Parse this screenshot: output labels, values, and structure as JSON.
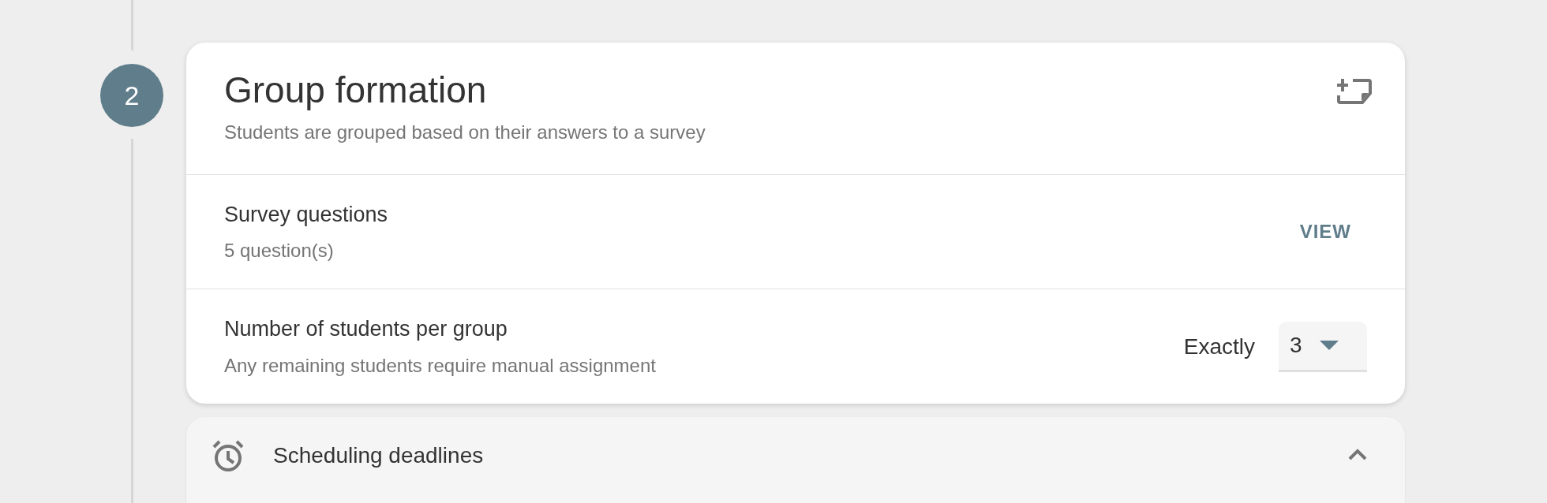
{
  "step": {
    "number": "2"
  },
  "card": {
    "title": "Group formation",
    "subtitle": "Students are grouped based on their answers to a survey",
    "rows": [
      {
        "kind": "action",
        "label": "Survey questions",
        "detail": "5 question(s)",
        "action": "VIEW"
      },
      {
        "kind": "select",
        "label": "Number of students per group",
        "detail": "Any remaining students require manual assignment",
        "prefix": "Exactly",
        "value": "3"
      }
    ]
  },
  "section": {
    "title": "Scheduling deadlines",
    "expanded": true
  }
}
